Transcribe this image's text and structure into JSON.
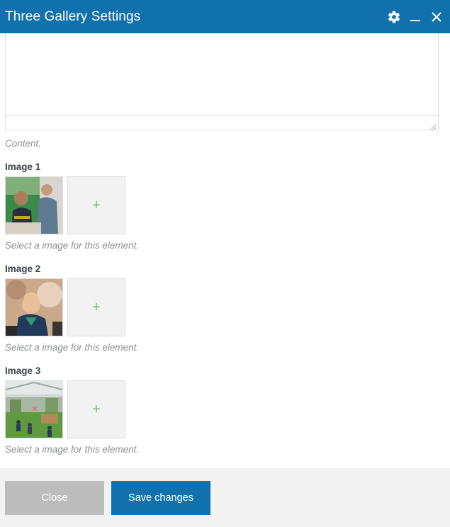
{
  "window": {
    "title": "Three Gallery Settings",
    "icons": [
      "gear-icon",
      "minimize-icon",
      "close-icon"
    ]
  },
  "editor": {
    "help": "Content."
  },
  "fields": [
    {
      "label": "Image 1",
      "help": "Select a image for this element.",
      "add_symbol": "+"
    },
    {
      "label": "Image 2",
      "help": "Select a image for this element.",
      "add_symbol": "+"
    },
    {
      "label": "Image 3",
      "help": "Select a image for this element.",
      "add_symbol": "+"
    }
  ],
  "footer": {
    "close_label": "Close",
    "save_label": "Save changes"
  },
  "colors": {
    "accent": "#1171ac",
    "plus": "#6cc66c",
    "disabled_button": "#bcbcbc"
  }
}
